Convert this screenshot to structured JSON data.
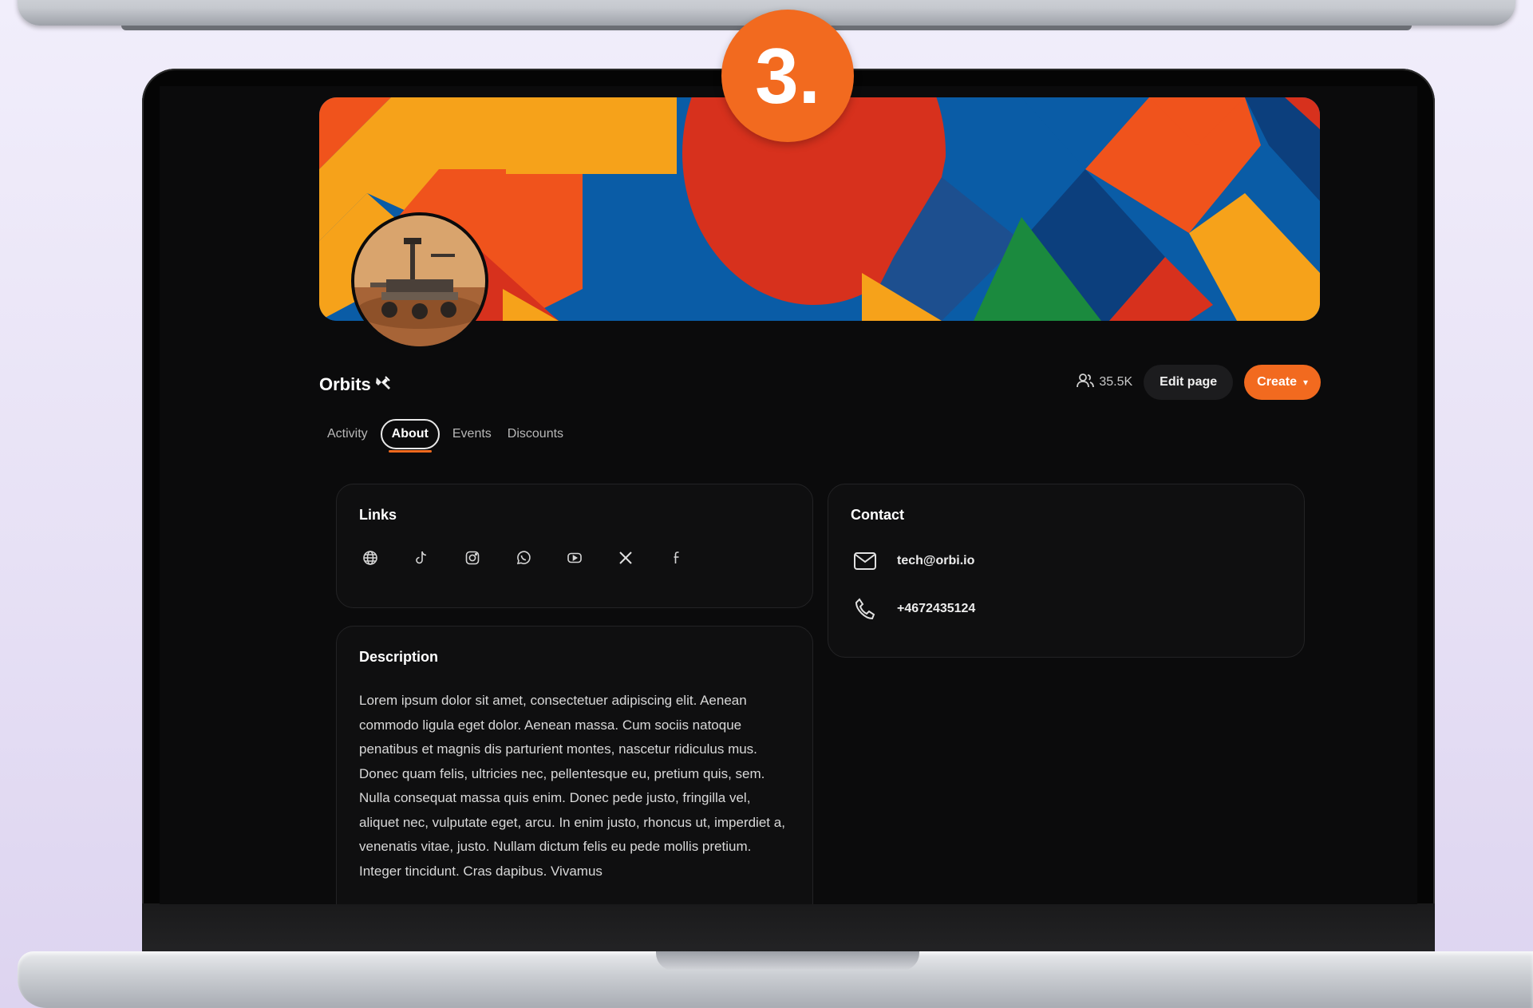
{
  "step_badge": "3.",
  "page": {
    "name": "Orbits",
    "name_emoji_icon": "satellite-icon"
  },
  "header": {
    "followers_icon": "users-icon",
    "followers_count": "35.5K",
    "edit_label": "Edit page",
    "create_label": "Create",
    "create_caret": "▾"
  },
  "tabs": [
    {
      "label": "Activity",
      "active": false
    },
    {
      "label": "About",
      "active": true
    },
    {
      "label": "Events",
      "active": false
    },
    {
      "label": "Discounts",
      "active": false
    }
  ],
  "links": {
    "title": "Links",
    "icons": [
      "globe-icon",
      "tiktok-icon",
      "instagram-icon",
      "whatsapp-icon",
      "youtube-icon",
      "x-icon",
      "facebook-icon"
    ]
  },
  "contact": {
    "title": "Contact",
    "email": "tech@orbi.io",
    "phone": "+4672435124"
  },
  "description": {
    "title": "Description",
    "text": "Lorem ipsum dolor sit amet, consectetuer adipiscing elit. Aenean commodo ligula eget dolor. Aenean massa. Cum sociis natoque penatibus et magnis dis parturient montes, nascetur ridiculus mus. Donec quam felis, ultricies nec, pellentesque eu, pretium quis, sem. Nulla consequat massa quis enim. Donec pede justo, fringilla vel, aliquet nec, vulputate eget, arcu. In enim justo, rhoncus ut, imperdiet a, venenatis vitae, justo. Nullam dictum felis eu pede mollis pretium. Integer tincidunt. Cras dapibus. Vivamus"
  },
  "colors": {
    "accent": "#f26a1f",
    "background": "#0b0b0c",
    "card": "#0f0f10",
    "cover_blue": "#0a5ca6",
    "cover_orange": "#f0531c",
    "cover_yellow": "#f6a21a",
    "cover_red": "#d7311d",
    "cover_green": "#1b8a3e"
  }
}
